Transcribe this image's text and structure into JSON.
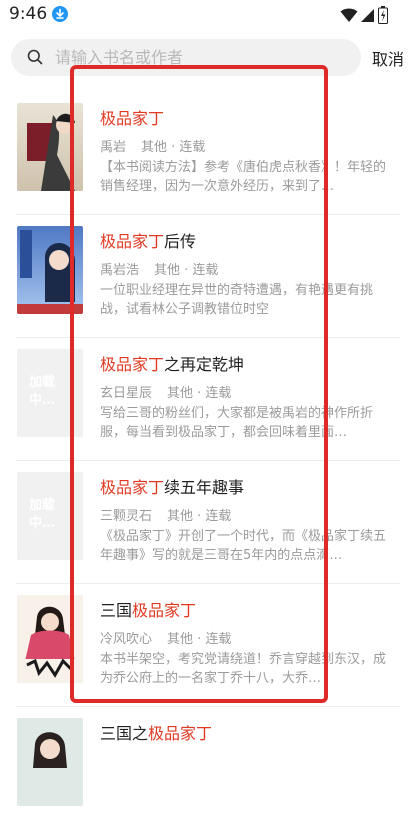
{
  "status_bar": {
    "time": "9:46"
  },
  "search": {
    "placeholder": "请输入书名或作者",
    "cancel_label": "取消"
  },
  "colors": {
    "highlight": "#e03a22",
    "annotation_border": "#e02a2a",
    "download_badge": "#2196f3"
  },
  "books": [
    {
      "title_pre": "",
      "title_hl": "极品家丁",
      "title_post": "",
      "author": "禹岩",
      "category": "其他 · 连载",
      "desc": "【本书阅读方法】参考《唐伯虎点秋香》！年轻的销售经理，因为一次意外经历，来到了…",
      "cover": "image"
    },
    {
      "title_pre": "",
      "title_hl": "极品家丁",
      "title_post": "后传",
      "author": "禹岩浩",
      "category": "其他 · 连载",
      "desc": "一位职业经理在异世的奇特遭遇，有艳遇更有挑战，试看林公子调教错位时空",
      "cover": "image"
    },
    {
      "title_pre": "",
      "title_hl": "极品家丁",
      "title_post": "之再定乾坤",
      "author": "玄日星辰",
      "category": "其他 · 连载",
      "desc": "写给三哥的粉丝们，大家都是被禹岩的神作所折服，每当看到极品家丁，都会回味着里面…",
      "cover": "loading",
      "cover_text": "加载中…"
    },
    {
      "title_pre": "",
      "title_hl": "极品家丁",
      "title_post": "续五年趣事",
      "author": "三颗灵石",
      "category": "其他 · 连载",
      "desc": "《极品家丁》开创了一个时代，而《极品家丁续五年趣事》写的就是三哥在5年内的点点滴…",
      "cover": "loading",
      "cover_text": "加载中…"
    },
    {
      "title_pre": "三国",
      "title_hl": "极品家丁",
      "title_post": "",
      "author": "冷风吹心",
      "category": "其他 · 连载",
      "desc": "本书半架空，考究党请绕道！乔言穿越到东汉，成为乔公府上的一名家丁乔十八，大乔…",
      "cover": "image"
    },
    {
      "title_pre": "三国之",
      "title_hl": "极品家丁",
      "title_post": "",
      "author": "",
      "category": "",
      "desc": "",
      "cover": "image"
    }
  ]
}
